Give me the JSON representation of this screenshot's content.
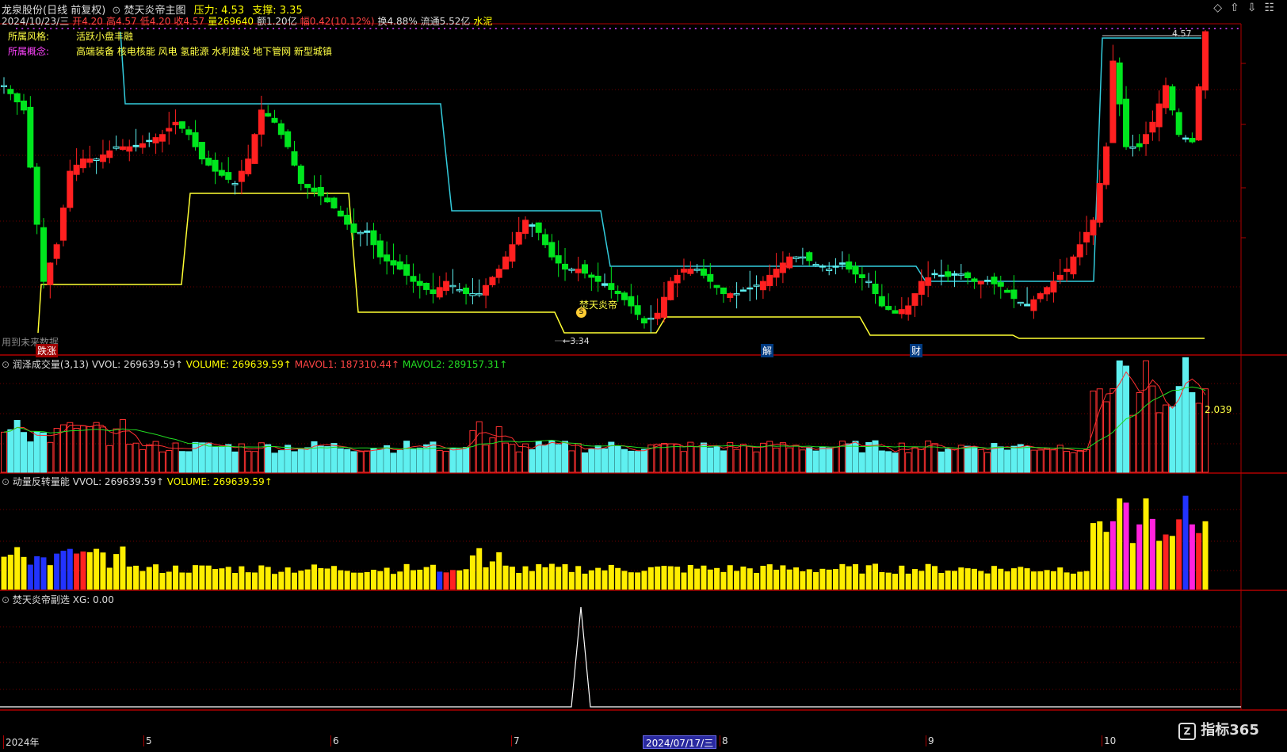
{
  "header": {
    "stock_name": "龙泉股份(日线 前复权)",
    "main_indicator": "焚天炎帝主图",
    "pressure_label": "压力:",
    "pressure_value": "4.53",
    "support_label": "支撑:",
    "support_value": "3.35",
    "bar_info": [
      {
        "label": "2024/10/23/三",
        "color": "#dddddd"
      },
      {
        "label": "开4.20",
        "color": "#ff4444"
      },
      {
        "label": "高4.57",
        "color": "#ff4444"
      },
      {
        "label": "低4.20",
        "color": "#ff4444"
      },
      {
        "label": "收4.57",
        "color": "#ff4444"
      },
      {
        "label": "量269640",
        "color": "#ffff00"
      },
      {
        "label": "额1.20亿",
        "color": "#dddddd"
      },
      {
        "label": "幅0.42(10.12%)",
        "color": "#ff4444"
      },
      {
        "label": "换4.88%",
        "color": "#dddddd"
      },
      {
        "label": "流通5.52亿",
        "color": "#dddddd"
      },
      {
        "label": "水泥",
        "color": "#ffff00"
      }
    ],
    "window_icons": [
      "diamond-icon",
      "up-arrow-icon",
      "down-arrow-icon",
      "more-icon"
    ]
  },
  "info_box": {
    "style_label": "所属风格:",
    "style_value": "活跃小盘丰融",
    "concept_label": "所属概念:",
    "concept_value": "高端装备 核电核能 风电 氢能源 水利建设 地下管网 新型城镇"
  },
  "main_chart": {
    "annotations": {
      "future_data": "用到未来数据",
      "zhangdie": "跌涨",
      "jie": "解",
      "cai": "财",
      "signal_name": "焚天炎帝",
      "high_price": "4.57",
      "low_price": "←3.34",
      "signal_badge": "S"
    }
  },
  "volume_panel": {
    "title": "润泽成交量(3,13)",
    "vvol": "VVOL: 269639.59↑",
    "volume": "VOLUME: 269639.59↑",
    "mavol1": "MAVOL1: 187310.44↑",
    "mavol2": "MAVOL2: 289157.31↑",
    "ratio_label": "2.039"
  },
  "momentum_panel": {
    "title": "动量反转量能",
    "vvol": "VVOL: 269639.59↑",
    "volume": "VOLUME: 269639.59↑"
  },
  "sub_panel": {
    "title": "焚天炎帝副选",
    "xg": "XG: 0.00"
  },
  "time_axis": {
    "labels": [
      {
        "text": "2024年",
        "pos": "start"
      },
      {
        "text": "5"
      },
      {
        "text": "6"
      },
      {
        "text": "7"
      },
      {
        "text": "8"
      },
      {
        "text": "9"
      },
      {
        "text": "10"
      }
    ],
    "cursor_date": "2024/07/17/三",
    "watermark": "指标365"
  },
  "colors": {
    "up": "#ff2020",
    "down": "#00e61e",
    "flat": "#5ef0f0",
    "pressure_line": "#33ccdd",
    "support_line": "#ffff33",
    "grid": "#7a0000",
    "volume_up": "#ff3030",
    "volume_down": "#5ff0f0",
    "momentum_yellow": "#ffee00",
    "momentum_magenta": "#ff22dd",
    "momentum_blue": "#2233ff"
  }
}
